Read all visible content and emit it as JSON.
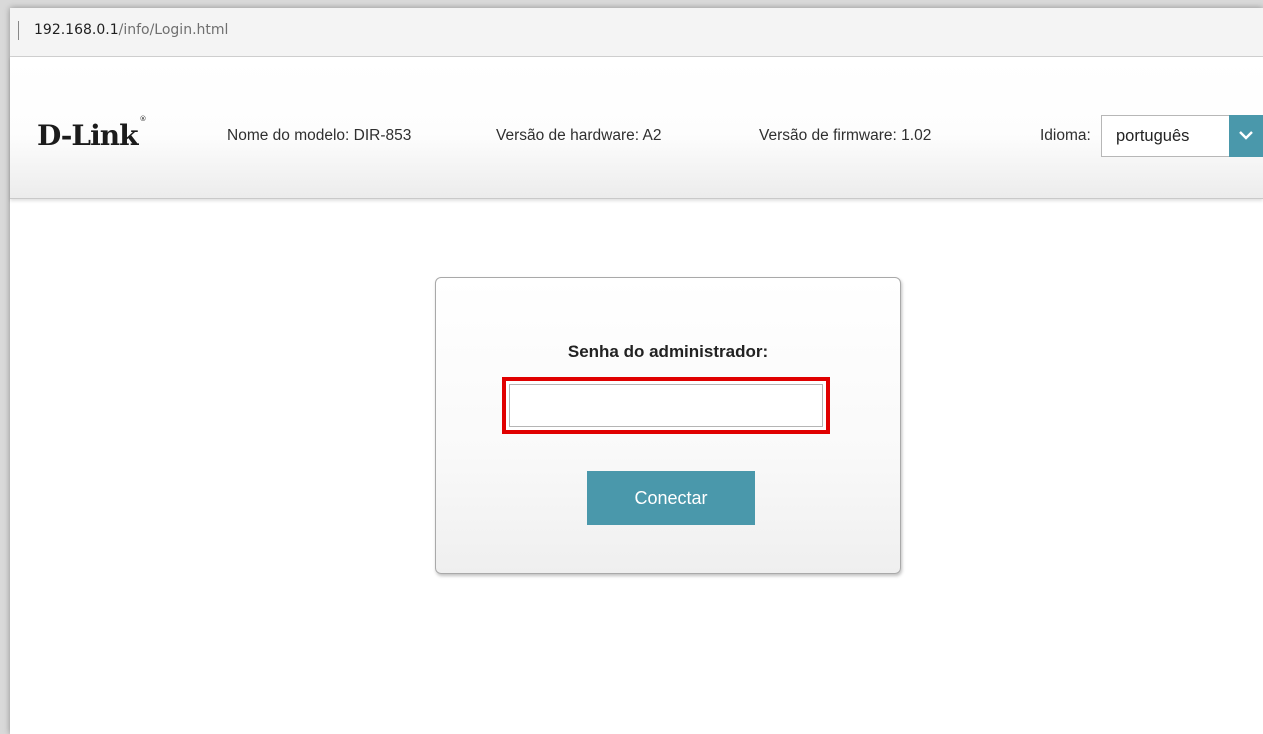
{
  "browser": {
    "url_host": "192.168.0.1",
    "url_path": "/info/Login.html"
  },
  "header": {
    "logo": "D-Link",
    "logo_mark": "®",
    "model": "Nome do modelo: DIR-853",
    "hardware": "Versão de hardware: A2",
    "firmware": "Versão de firmware: 1.02",
    "language_label": "Idioma:",
    "language_value": "português"
  },
  "login": {
    "password_label": "Senha do administrador:",
    "password_value": "",
    "connect_label": "Conectar"
  },
  "colors": {
    "accent": "#4a98ab",
    "highlight": "#e00000"
  },
  "icons": {
    "language_dropdown": "chevron-down-icon"
  }
}
